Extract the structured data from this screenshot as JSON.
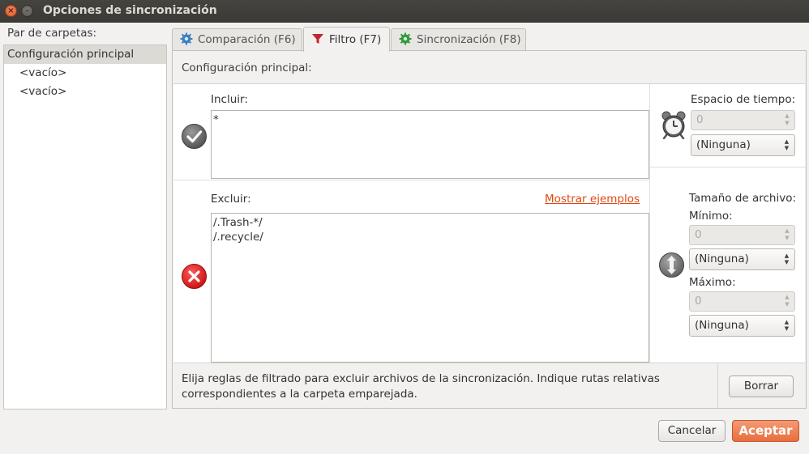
{
  "window": {
    "title": "Opciones de sincronización",
    "close_glyph": "×",
    "minimize_glyph": "–"
  },
  "sidebar": {
    "label": "Par de carpetas:",
    "items": [
      {
        "label": "Configuración principal",
        "selected": true
      },
      {
        "label": "<vacío>",
        "selected": false
      },
      {
        "label": "<vacío>",
        "selected": false
      }
    ]
  },
  "tabs": [
    {
      "label": "Comparación (F6)",
      "icon": "gear-blue-icon",
      "active": false
    },
    {
      "label": "Filtro (F7)",
      "icon": "funnel-icon",
      "active": true
    },
    {
      "label": "Sincronización (F8)",
      "icon": "gear-green-icon",
      "active": false
    }
  ],
  "filter": {
    "config_label": "Configuración principal:",
    "include_label": "Incluir:",
    "include_value": "*",
    "exclude_label": "Excluir:",
    "exclude_value": "/.Trash-*/\n/.recycle/",
    "show_examples": "Mostrar ejemplos",
    "timespan_label": "Espacio de tiempo:",
    "timespan_value": "0",
    "timespan_unit": "(Ninguna)",
    "filesize_label": "Tamaño de archivo:",
    "min_label": "Mínimo:",
    "min_value": "0",
    "min_unit": "(Ninguna)",
    "max_label": "Máximo:",
    "max_value": "0",
    "max_unit": "(Ninguna)",
    "hint": "Elija reglas de filtrado para excluir archivos de la sincronización. Indique rutas relativas correspondientes a la carpeta emparejada.",
    "clear_button": "Borrar"
  },
  "footer": {
    "cancel": "Cancelar",
    "accept": "Aceptar"
  },
  "colors": {
    "accent": "#e8703f",
    "link": "#dd4814",
    "include_icon": "#6d6d6d",
    "exclude_icon": "#e02020"
  }
}
